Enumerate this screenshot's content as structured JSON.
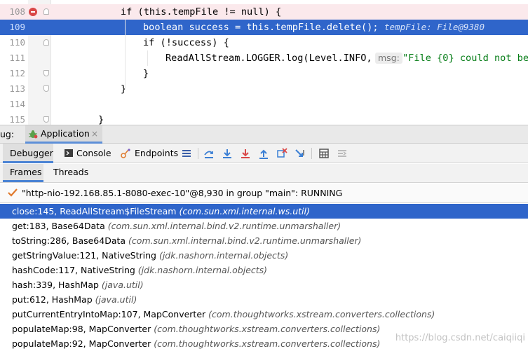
{
  "editor": {
    "lines": [
      {
        "n": "108",
        "code": "if (this.tempFile != null) {"
      },
      {
        "n": "109",
        "code": "boolean success = this.tempFile.delete();",
        "inline_value": "tempFile: File@9380"
      },
      {
        "n": "110",
        "code": "if (!success) {"
      },
      {
        "n": "111",
        "code_before": "ReadAllStream.LOGGER.log(Level.INFO,",
        "hint": "msg:",
        "code_str": "\"File {0} could not be"
      },
      {
        "n": "112",
        "code": "}"
      },
      {
        "n": "113",
        "code": "}"
      },
      {
        "n": "114",
        "code": ""
      },
      {
        "n": "115",
        "code": "}"
      }
    ]
  },
  "debug": {
    "title": "ug:",
    "app_tab": "Application",
    "app_tab_close": "×"
  },
  "toolbar": {
    "debugger": "Debugger",
    "console": "Console",
    "endpoints": "Endpoints"
  },
  "subtabs": {
    "frames": "Frames",
    "threads": "Threads"
  },
  "thread": "\"http-nio-192.168.85.1-8080-exec-10\"@8,930 in group \"main\": RUNNING",
  "frames": [
    {
      "method": "close:145, ReadAllStream$FileStream",
      "pkg": "(com.sun.xml.internal.ws.util)"
    },
    {
      "method": "get:183, Base64Data",
      "pkg": "(com.sun.xml.internal.bind.v2.runtime.unmarshaller)"
    },
    {
      "method": "toString:286, Base64Data",
      "pkg": "(com.sun.xml.internal.bind.v2.runtime.unmarshaller)"
    },
    {
      "method": "getStringValue:121, NativeString",
      "pkg": "(jdk.nashorn.internal.objects)"
    },
    {
      "method": "hashCode:117, NativeString",
      "pkg": "(jdk.nashorn.internal.objects)"
    },
    {
      "method": "hash:339, HashMap",
      "pkg": "(java.util)"
    },
    {
      "method": "put:612, HashMap",
      "pkg": "(java.util)"
    },
    {
      "method": "putCurrentEntryIntoMap:107, MapConverter",
      "pkg": "(com.thoughtworks.xstream.converters.collections)"
    },
    {
      "method": "populateMap:98, MapConverter",
      "pkg": "(com.thoughtworks.xstream.converters.collections)"
    },
    {
      "method": "populateMap:92, MapConverter",
      "pkg": "(com.thoughtworks.xstream.converters.collections)"
    }
  ],
  "watermark": "https://blog.csdn.net/caiqiiqi",
  "colors": {
    "selection": "#2f65ca",
    "breakpoint": "#d94747",
    "keyword": "#000080",
    "string": "#067d17",
    "tab_underline": "#4a83d4"
  }
}
